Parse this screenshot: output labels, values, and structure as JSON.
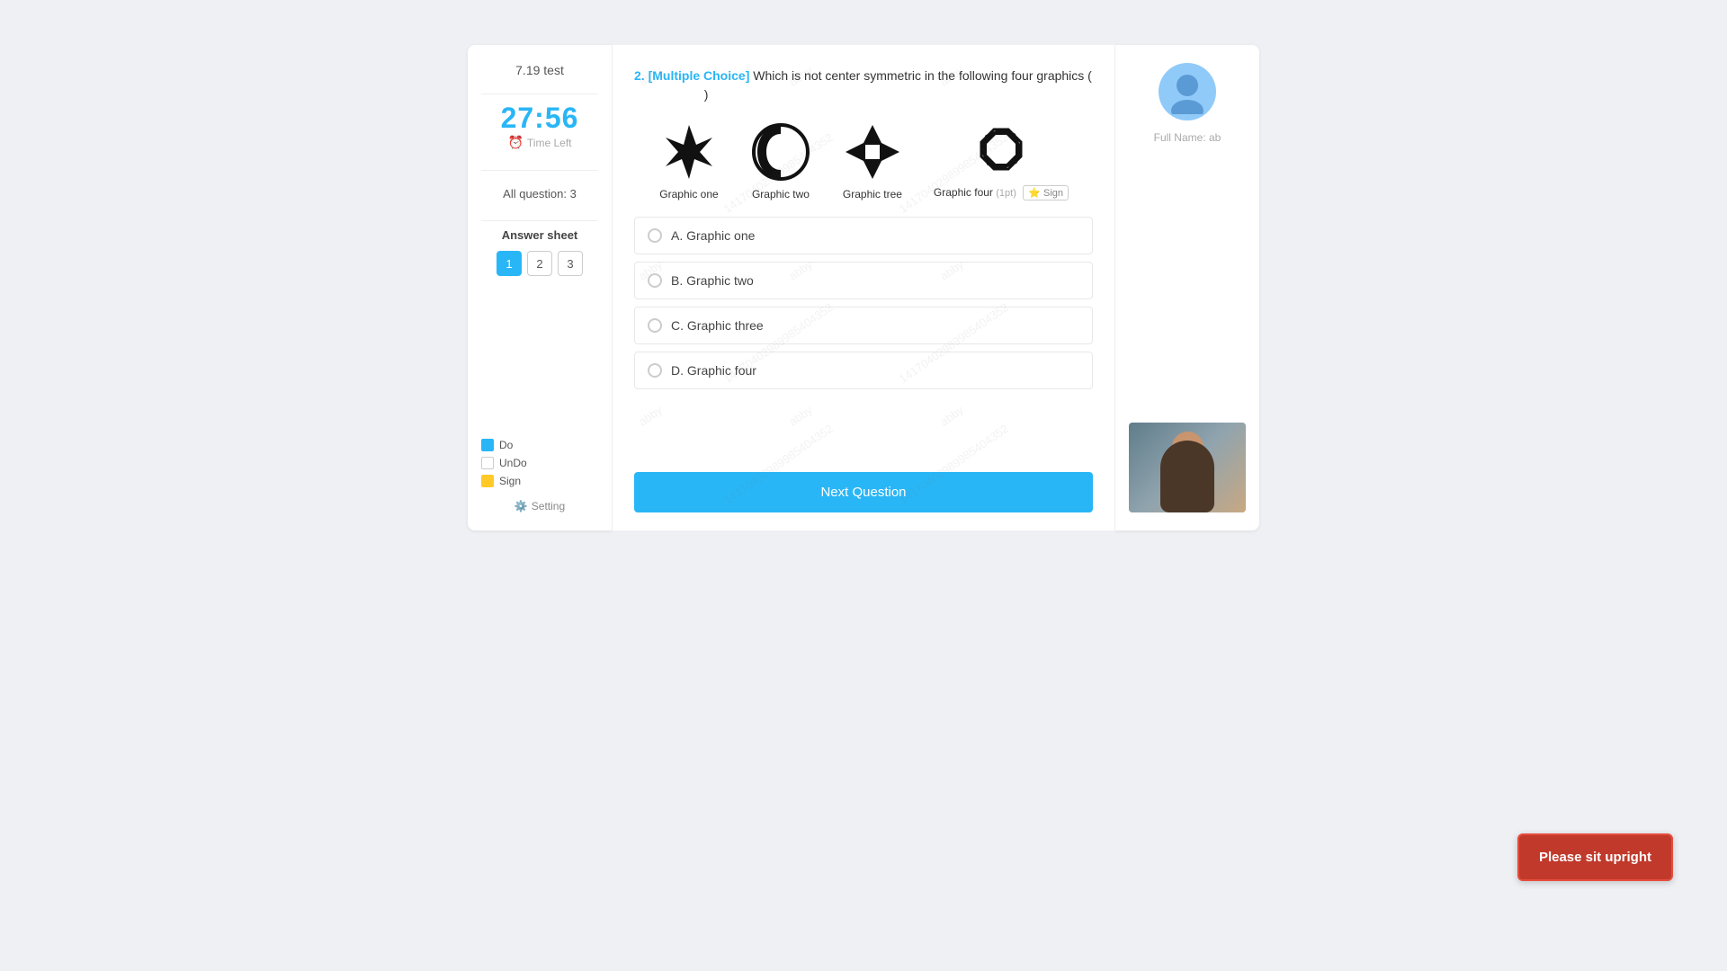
{
  "app": {
    "title": "7.19 test"
  },
  "timer": {
    "value": "27:56",
    "label": "Time Left"
  },
  "question_info": {
    "all_question_label": "All question: 3"
  },
  "answer_sheet": {
    "title": "Answer sheet",
    "numbers": [
      {
        "value": "1",
        "active": true
      },
      {
        "value": "2",
        "active": false
      },
      {
        "value": "3",
        "active": false
      }
    ]
  },
  "legend": {
    "do_label": "Do",
    "undo_label": "UnDo",
    "sign_label": "Sign"
  },
  "setting": {
    "label": "Setting"
  },
  "question": {
    "number": "2.",
    "type": "[Multiple Choice]",
    "text": "Which is not center symmetric in the following four graphics (",
    "points": "1pt",
    "sign_label": "Sign"
  },
  "graphics": [
    {
      "label": "Graphic one",
      "type": "pinwheel"
    },
    {
      "label": "Graphic two",
      "type": "swoosh"
    },
    {
      "label": "Graphic tree",
      "type": "cross"
    },
    {
      "label": "Graphic four",
      "type": "hexspin",
      "points": "(1pt)",
      "has_sign": true
    }
  ],
  "options": [
    {
      "letter": "A",
      "text": "A. Graphic one"
    },
    {
      "letter": "B",
      "text": "B. Graphic two"
    },
    {
      "letter": "C",
      "text": "C. Graphic three"
    },
    {
      "letter": "D",
      "text": "D. Graphic four"
    }
  ],
  "next_button": {
    "label": "Next Question"
  },
  "user": {
    "full_name_label": "Full Name:",
    "full_name_value": "ab"
  },
  "alert": {
    "message": "Please sit upright"
  },
  "watermark": {
    "text": "abby"
  }
}
